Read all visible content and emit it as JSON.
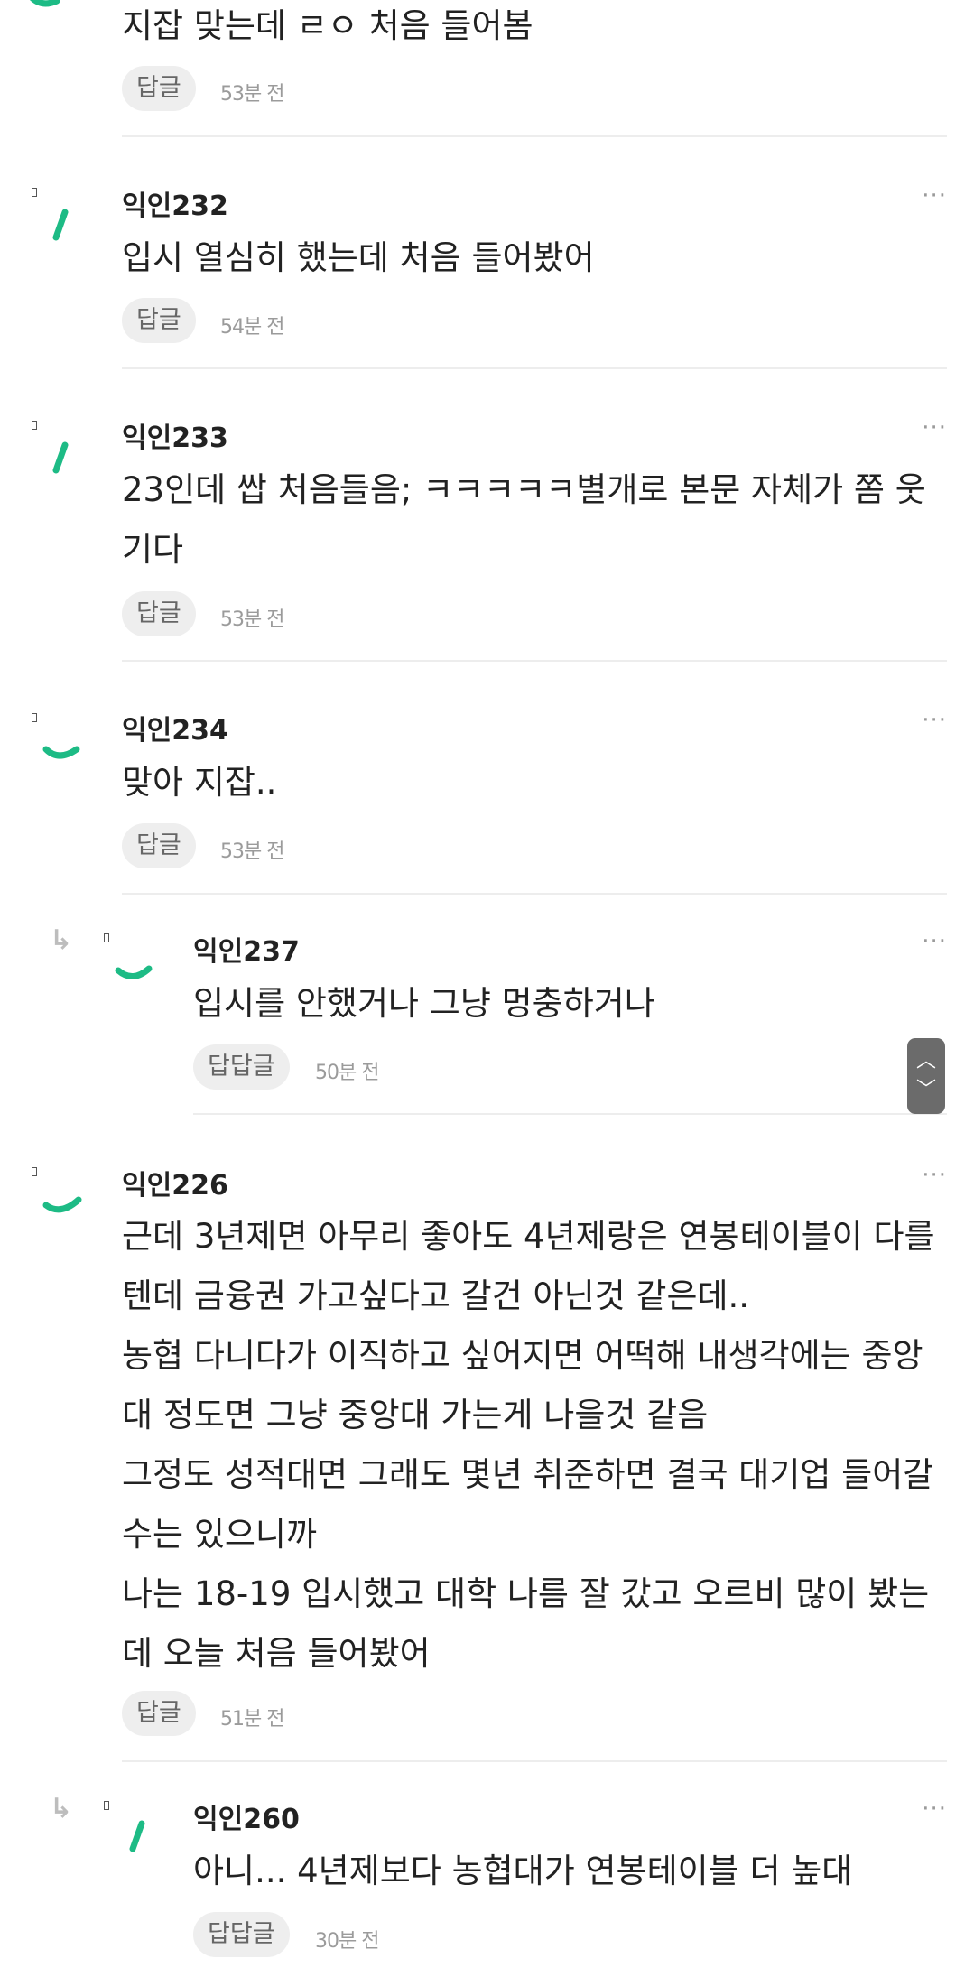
{
  "reply_label": "답글",
  "nested_reply_label": "답답글",
  "more_glyph": "···",
  "accent_color": "#1dbb85",
  "top_fragment": {
    "text": "지잡 맞는데 ㄹㅇ 처음 들어봄",
    "time": "53분 전"
  },
  "comments": [
    {
      "nick": "익인232",
      "lines": [
        "입시 열심히 했는데 처음 들어봤어"
      ],
      "time": "54분 전"
    },
    {
      "nick": "익인233",
      "lines": [
        "23인데 쌉 처음들음; ㅋㅋㅋㅋㅋ별개로 본문 자체가 쫌 웃",
        "기다"
      ],
      "time": "53분 전"
    },
    {
      "nick": "익인234",
      "lines": [
        "맞아 지잡.."
      ],
      "time": "53분 전"
    },
    {
      "nick": "익인237",
      "lines": [
        "입시를 안했거나 그냥 멍충하거나"
      ],
      "time": "50분 전"
    },
    {
      "nick": "익인226",
      "lines": [
        "근데 3년제면 아무리 좋아도 4년제랑은 연봉테이블이 다를",
        "텐데 금융권 가고싶다고 갈건 아닌것 같은데..",
        "농협 다니다가 이직하고 싶어지면 어떡해 내생각에는 중앙",
        "대 정도면 그냥 중앙대 가는게 나을것 같음",
        "그정도 성적대면 그래도 몇년 취준하면 결국 대기업 들어갈",
        "수는 있으니까",
        "나는 18-19 입시했고 대학 나름 잘 갔고 오르비 많이 봤는",
        "데 오늘 처음 들어봤어"
      ],
      "time": "51분 전"
    },
    {
      "nick": "익인260",
      "lines": [
        "아니... 4년제보다 농협대가 연봉테이블 더 높대"
      ],
      "time": "30분 전"
    }
  ],
  "scroll_controls": {
    "up_glyph": "︿",
    "down_glyph": "﹀"
  }
}
